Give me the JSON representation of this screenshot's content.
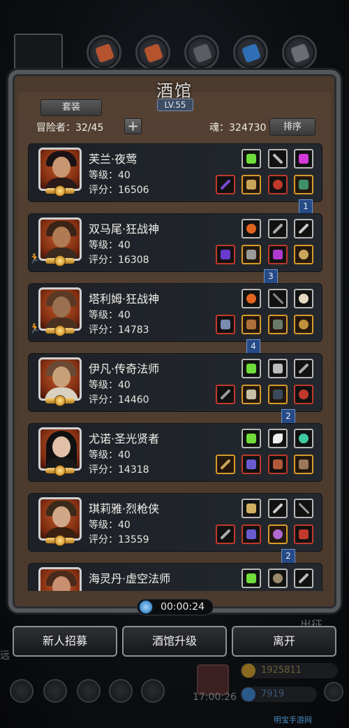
{
  "title": "酒馆",
  "level": "LV.55",
  "set_button": "套装",
  "adventurers_label": "冒险者：32/45",
  "soul_label": "魂：324730",
  "sort_button": "排序",
  "timer": "00:00:24",
  "bottom": {
    "recruit": "新人招募",
    "upgrade": "酒馆升级",
    "leave": "离开"
  },
  "background_text": {
    "expedition": "出征",
    "left_char": "远",
    "timer2": "17:00:26",
    "gold": "1925811",
    "gems": "7919",
    "watermark": "明宝手游网"
  },
  "labels": {
    "level": "等级：",
    "score": "评分："
  },
  "heroes": [
    {
      "name": "芙兰·夜莺",
      "level": "40",
      "score": "16506",
      "portrait_color": "#8a2a1a",
      "rank_after": "1"
    },
    {
      "name": "双马尾·狂战神",
      "level": "40",
      "score": "16308",
      "portrait_color": "#9a4a2a",
      "rank_after": "3"
    },
    {
      "name": "塔利姆·狂战神",
      "level": "40",
      "score": "14783",
      "portrait_color": "#7a3a20",
      "rank_after": "4"
    },
    {
      "name": "伊凡·传奇法师",
      "level": "40",
      "score": "14460",
      "portrait_color": "#a05a30",
      "rank_after": "2"
    },
    {
      "name": "尤诺·圣光贤者",
      "level": "40",
      "score": "14318",
      "portrait_color": "#5a1a10",
      "rank_after": ""
    },
    {
      "name": "琪莉雅·烈枪侠",
      "level": "40",
      "score": "13559",
      "portrait_color": "#8a3a1a",
      "rank_after": "2"
    },
    {
      "name": "海灵丹·虚空法师",
      "level": "",
      "score": "",
      "portrait_color": "#7a2a18",
      "rank_after": ""
    }
  ],
  "colors": {
    "accent_gold": "#d89a2a",
    "rank_blue": "#264a85",
    "panel_brown": "#4a392c",
    "card_dark": "#1f2329"
  }
}
